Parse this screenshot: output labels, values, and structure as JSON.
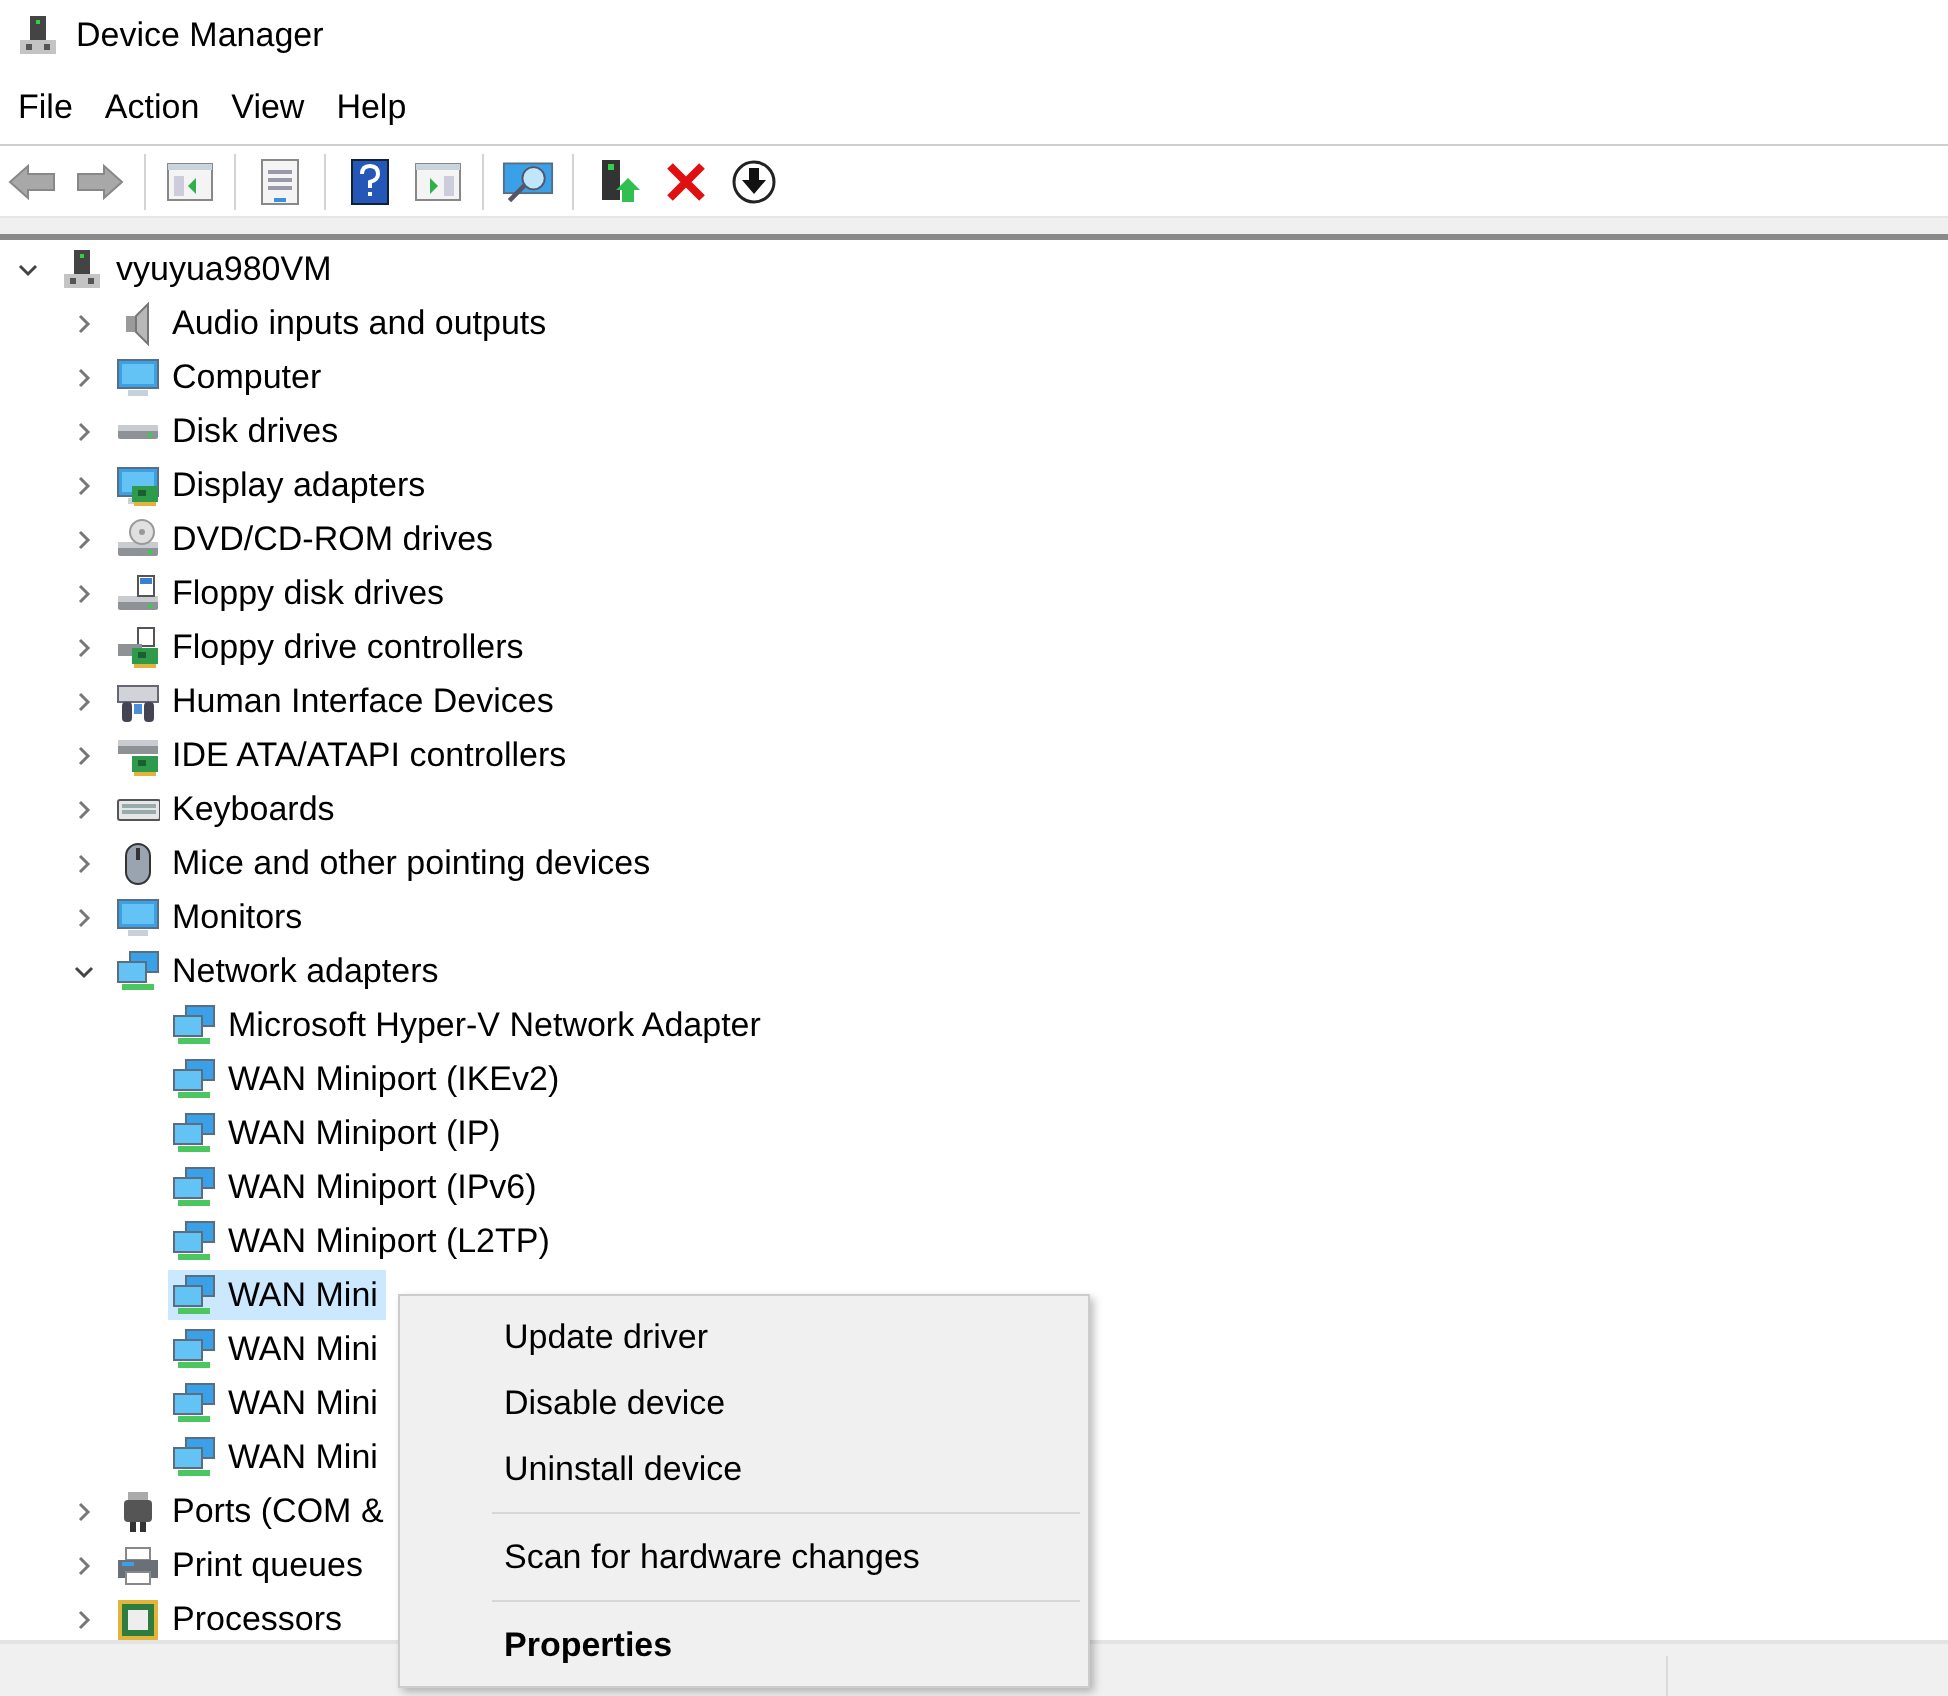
{
  "window": {
    "title": "Device Manager"
  },
  "menu_bar": [
    "File",
    "Action",
    "View",
    "Help"
  ],
  "tree": {
    "label": "vyuyua980VM",
    "expanded": true,
    "selected": false,
    "children": [
      {
        "label": "Audio inputs and outputs",
        "expanded": false,
        "selected": false
      },
      {
        "label": "Computer",
        "expanded": false,
        "selected": false
      },
      {
        "label": "Disk drives",
        "expanded": false,
        "selected": false
      },
      {
        "label": "Display adapters",
        "expanded": false,
        "selected": false
      },
      {
        "label": "DVD/CD-ROM drives",
        "expanded": false,
        "selected": false
      },
      {
        "label": "Floppy disk drives",
        "expanded": false,
        "selected": false
      },
      {
        "label": "Floppy drive controllers",
        "expanded": false,
        "selected": false
      },
      {
        "label": "Human Interface Devices",
        "expanded": false,
        "selected": false
      },
      {
        "label": "IDE ATA/ATAPI controllers",
        "expanded": false,
        "selected": false
      },
      {
        "label": "Keyboards",
        "expanded": false,
        "selected": false
      },
      {
        "label": "Mice and other pointing devices",
        "expanded": false,
        "selected": false
      },
      {
        "label": "Monitors",
        "expanded": false,
        "selected": false
      },
      {
        "label": "Network adapters",
        "expanded": true,
        "selected": false,
        "children": [
          {
            "label": "Microsoft Hyper-V Network Adapter",
            "selected": false
          },
          {
            "label": "WAN Miniport (IKEv2)",
            "selected": false
          },
          {
            "label": "WAN Miniport (IP)",
            "selected": false
          },
          {
            "label": "WAN Miniport (IPv6)",
            "selected": false
          },
          {
            "label": "WAN Miniport (L2TP)",
            "selected": false
          },
          {
            "label": "WAN Mini",
            "selected": true
          },
          {
            "label": "WAN Mini",
            "selected": false
          },
          {
            "label": "WAN Mini",
            "selected": false
          },
          {
            "label": "WAN Mini",
            "selected": false
          }
        ]
      },
      {
        "label": "Ports (COM &",
        "expanded": false,
        "selected": false
      },
      {
        "label": "Print queues",
        "expanded": false,
        "selected": false
      },
      {
        "label": "Processors",
        "expanded": false,
        "selected": false
      }
    ]
  },
  "context_menu": {
    "items": [
      {
        "kind": "item",
        "label": "Update driver"
      },
      {
        "kind": "item",
        "label": "Disable device"
      },
      {
        "kind": "item",
        "label": "Uninstall device"
      },
      {
        "kind": "separator"
      },
      {
        "kind": "item",
        "label": "Scan for hardware changes"
      },
      {
        "kind": "separator"
      },
      {
        "kind": "default",
        "label": "Properties"
      }
    ]
  }
}
